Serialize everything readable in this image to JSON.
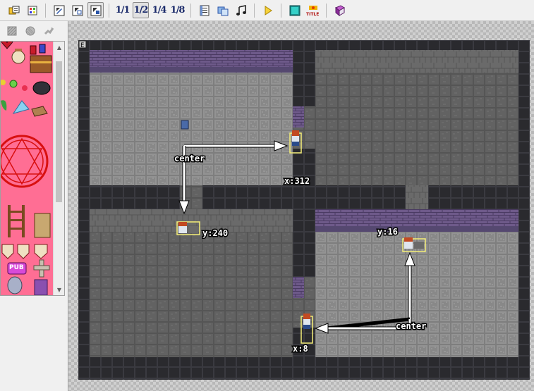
{
  "toolbar": {
    "buttons": [
      {
        "name": "open-project-icon"
      },
      {
        "name": "game-database-icon"
      },
      {
        "name": "pencil-draw-icon"
      },
      {
        "name": "rectangle-draw-icon"
      },
      {
        "name": "map-select-icon",
        "active": true
      },
      {
        "name": "zoom-1-1-button",
        "label": "1/1"
      },
      {
        "name": "zoom-1-2-button",
        "label": "1/2",
        "active": true
      },
      {
        "name": "zoom-1-4-button",
        "label": "1/4"
      },
      {
        "name": "zoom-1-8-button",
        "label": "1/8"
      },
      {
        "name": "event-list-icon"
      },
      {
        "name": "resource-manager-icon"
      },
      {
        "name": "sound-test-icon"
      },
      {
        "name": "playtest-icon"
      },
      {
        "name": "fullscreen-toggle-icon"
      },
      {
        "name": "title-screen-icon",
        "label": "TITLE"
      },
      {
        "name": "help-book-icon"
      }
    ]
  },
  "palette": {
    "tool_icons": [
      "lower-layer-icon",
      "upper-layer-icon",
      "region-brush-icon"
    ]
  },
  "map": {
    "corner_badge": "E",
    "annotations": {
      "center_top": "center",
      "center_bottom": "center",
      "x_top": "x:312",
      "y_left": "y:240",
      "y_right": "y:16",
      "x_bottom": "x:8"
    }
  },
  "colors": {
    "wall_dark": "#2a2a2e",
    "floor": "#8a8a8a",
    "brick": "#6e5a8a",
    "selection": "#f4ee78",
    "palette_bg": "#ff6e94"
  }
}
